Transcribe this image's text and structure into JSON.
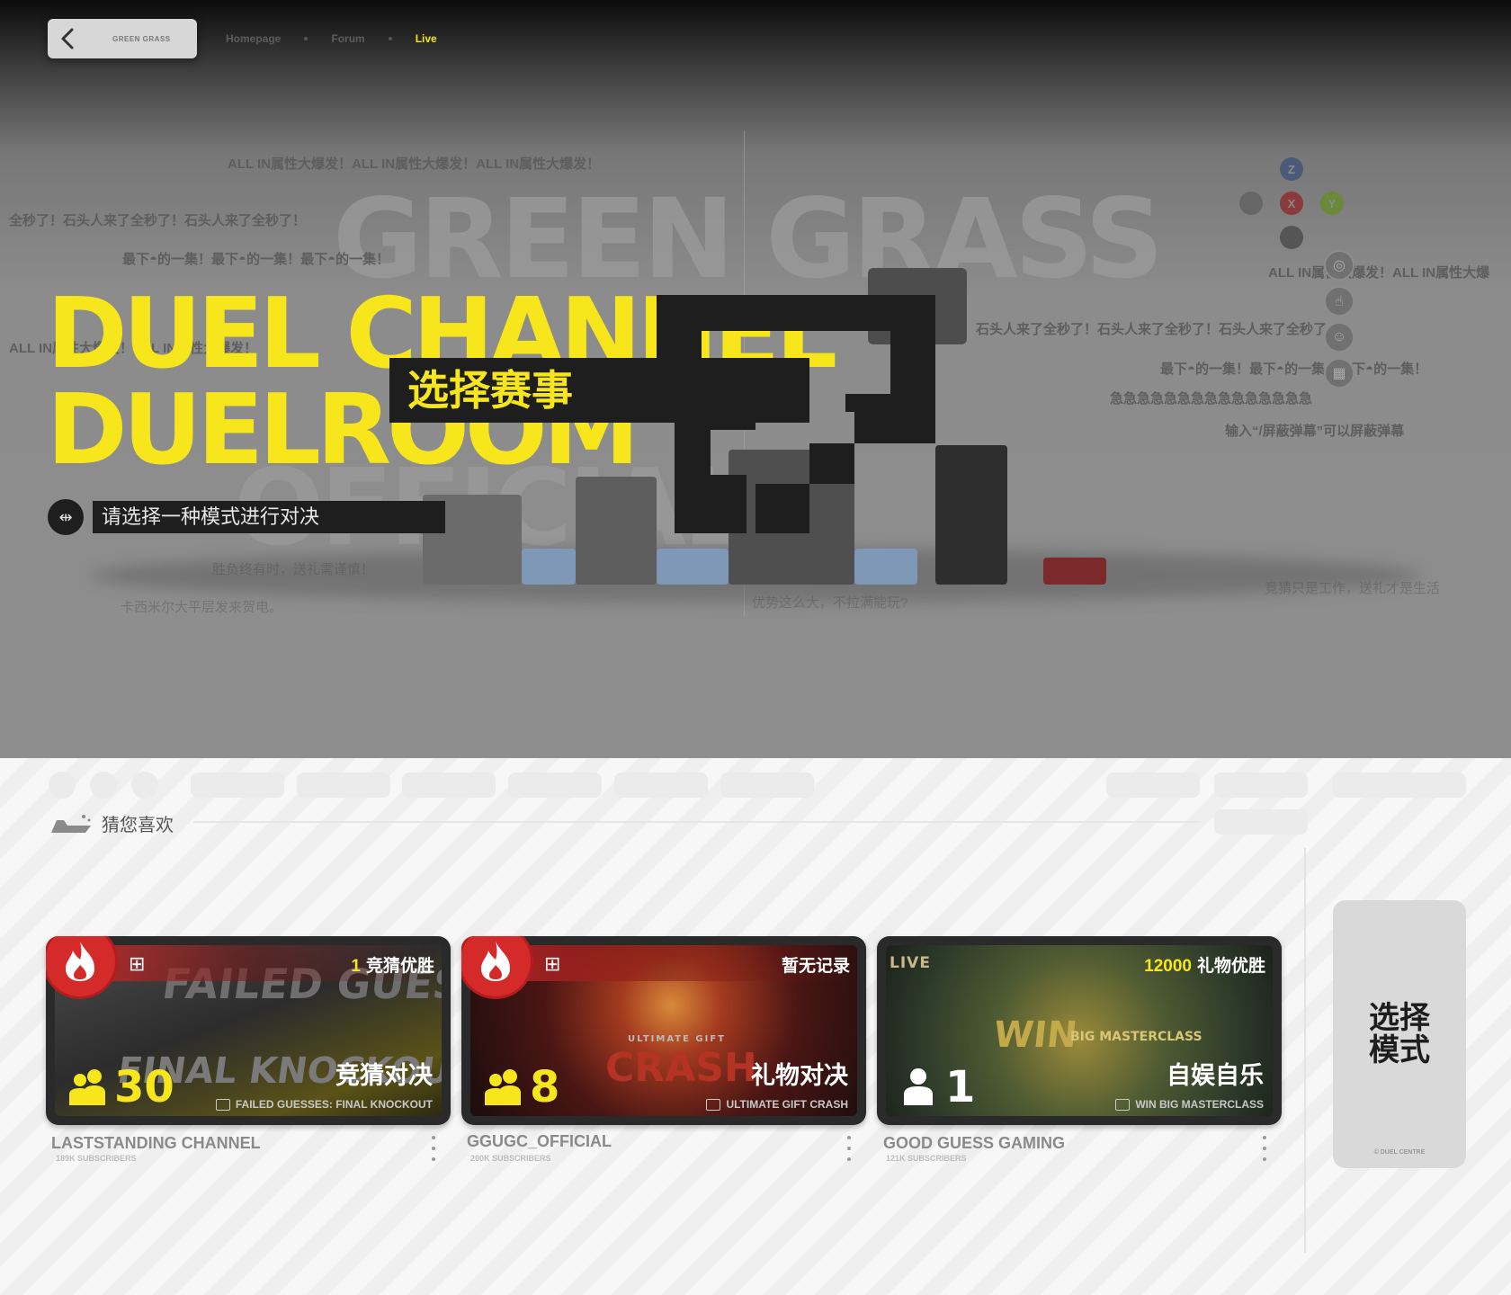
{
  "nav": {
    "back_brand": "GREEN GRASS",
    "breadcrumbs": [
      "Homepage",
      "Forum",
      "Live"
    ]
  },
  "hero": {
    "bg_word_1": "GREEN GRASS",
    "bg_word_2": "OFFICIAL",
    "title_line_1": "DUEL CHANNEL",
    "title_line_2": "DUELROOM",
    "select_event": "选择赛事",
    "mode_prompt": "请选择一种模式进行对决",
    "controller_buttons": [
      "Z",
      "X",
      "Y"
    ],
    "danmaku": [
      "ALL IN属性大爆发！ALL IN属性大爆发！ALL IN属性大爆发！",
      "全秒了！石头人来了全秒了！石头人来了全秒了！",
      "最下◓的一集！最下◓的一集！最下◓的一集！",
      "ALL IN属性大爆发！ALL IN属性大爆发！",
      "ALL IN属性大爆发！ALL IN属性大爆",
      "石头人来了全秒了！石头人来了全秒了！石头人来了全秒了",
      "最下◓的一集！最下◓的一集！最下◓的一集！",
      "急急急急急急急急急急急急急急急",
      "输入“/屏蔽弹幕”可以屏蔽弹幕",
      "胜负终有时，送礼需谨慎！",
      "卡西米尔大平层发来贺电。",
      "优势这么大，不拉满能玩?",
      "竞猜只是工作，送礼才是生活"
    ]
  },
  "section": {
    "guess_title": "猜您喜欢"
  },
  "cards": [
    {
      "top_number": "1",
      "top_text": "竞猜优胜",
      "viewers": "30",
      "mode": "竞猜对决",
      "video_title": "FAILED GUESSES: FINAL KNOCKOUT",
      "art_line_1": "FAILED GUESSES",
      "art_line_2": "FINAL KNOCKOUT",
      "channel": "LASTSTANDING CHANNEL",
      "subs": "189K SUBSCRIBERS"
    },
    {
      "top_number": "",
      "top_text": "暂无记录",
      "viewers": "8",
      "mode": "礼物对决",
      "video_title": "ULTIMATE GIFT CRASH",
      "art_line_1": "ULTIMATE GIFT",
      "art_line_2": "CRASH",
      "channel": "GGUGC_OFFICIAL",
      "subs": "200K SUBSCRIBERS"
    },
    {
      "live_label": "LIVE",
      "top_number": "12000",
      "top_text": "礼物优胜",
      "viewers": "1",
      "mode": "自娱自乐",
      "video_title": "WIN BIG MASTERCLASS",
      "art_line_1": "WIN",
      "art_line_2": "BIG MASTERCLASS",
      "channel": "GOOD GUESS GAMING",
      "subs": "121K SUBSCRIBERS"
    }
  ],
  "choose_mode": {
    "label": "选择模式",
    "footer": "© DUEL CENTRE"
  },
  "colors": {
    "accent_yellow": "#f6e61b",
    "fire_red": "#d42a2a",
    "dark": "#1e1e1e"
  }
}
